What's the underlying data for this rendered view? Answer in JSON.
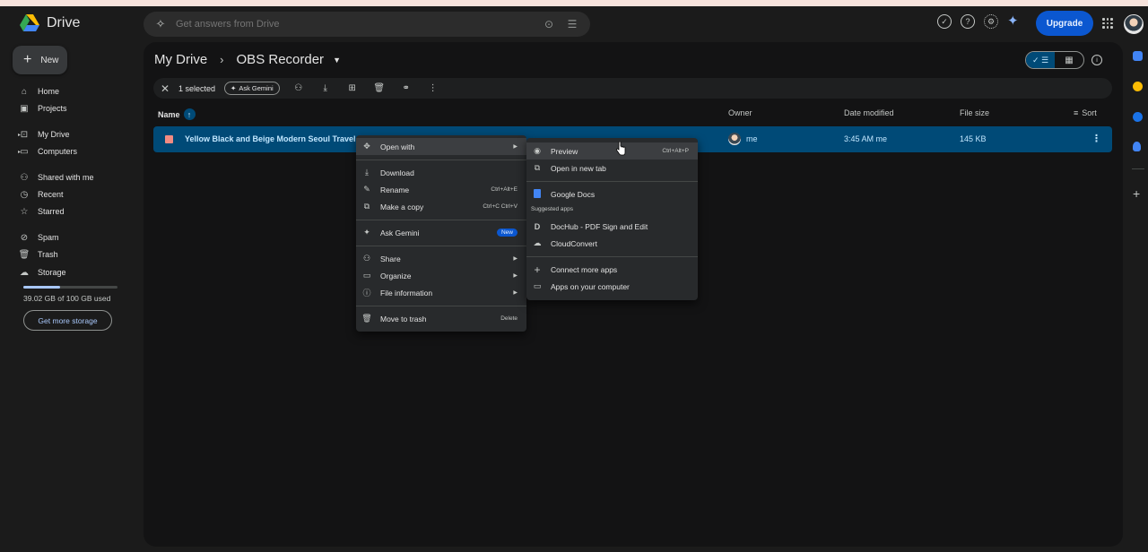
{
  "app": {
    "name": "Drive"
  },
  "search": {
    "placeholder": "Get answers from Drive"
  },
  "header": {
    "upgrade_label": "Upgrade"
  },
  "sidebar": {
    "new_label": "New",
    "items": [
      {
        "label": "Home",
        "icon": "home-icon"
      },
      {
        "label": "Projects",
        "icon": "projects-icon"
      },
      {
        "label": "My Drive",
        "icon": "my-drive-icon"
      },
      {
        "label": "Computers",
        "icon": "computers-icon"
      },
      {
        "label": "Shared with me",
        "icon": "shared-icon"
      },
      {
        "label": "Recent",
        "icon": "recent-icon"
      },
      {
        "label": "Starred",
        "icon": "star-icon"
      },
      {
        "label": "Spam",
        "icon": "spam-icon"
      },
      {
        "label": "Trash",
        "icon": "trash-icon"
      },
      {
        "label": "Storage",
        "icon": "cloud-icon"
      }
    ],
    "storage_text": "39.02 GB of 100 GB used",
    "storage_used_fraction": 0.39,
    "more_storage_label": "Get more storage"
  },
  "breadcrumb": {
    "root": "My Drive",
    "current": "OBS Recorder"
  },
  "selection": {
    "count_label": "1 selected",
    "ask_gemini": "Ask Gemini"
  },
  "columns": {
    "name": "Name",
    "owner": "Owner",
    "modified": "Date modified",
    "size": "File size",
    "sort": "Sort"
  },
  "file": {
    "name": "Yellow Black and Beige Modern Seoul Travel You",
    "owner": "me",
    "modified": "3:45 AM me",
    "size": "145 KB"
  },
  "context_menu": {
    "open_with": "Open with",
    "download": "Download",
    "rename": "Rename",
    "rename_shortcut": "Ctrl+Alt+E",
    "make_copy": "Make a copy",
    "make_copy_shortcut": "Ctrl+C Ctrl+V",
    "ask_gemini": "Ask Gemini",
    "new_badge": "New",
    "share": "Share",
    "organize": "Organize",
    "file_information": "File information",
    "move_to_trash": "Move to trash",
    "move_to_trash_shortcut": "Delete"
  },
  "open_with_menu": {
    "preview": "Preview",
    "preview_shortcut": "Ctrl+Alt+P",
    "open_new_tab": "Open in new tab",
    "google_docs": "Google Docs",
    "suggested_label": "Suggested apps",
    "dochub": "DocHub - PDF Sign and Edit",
    "cloudconvert": "CloudConvert",
    "connect_more": "Connect more apps",
    "apps_on_computer": "Apps on your computer"
  },
  "colors": {
    "accent": "#0b57d0",
    "selected_row": "#004a77",
    "selected_text": "#c2e7ff"
  }
}
